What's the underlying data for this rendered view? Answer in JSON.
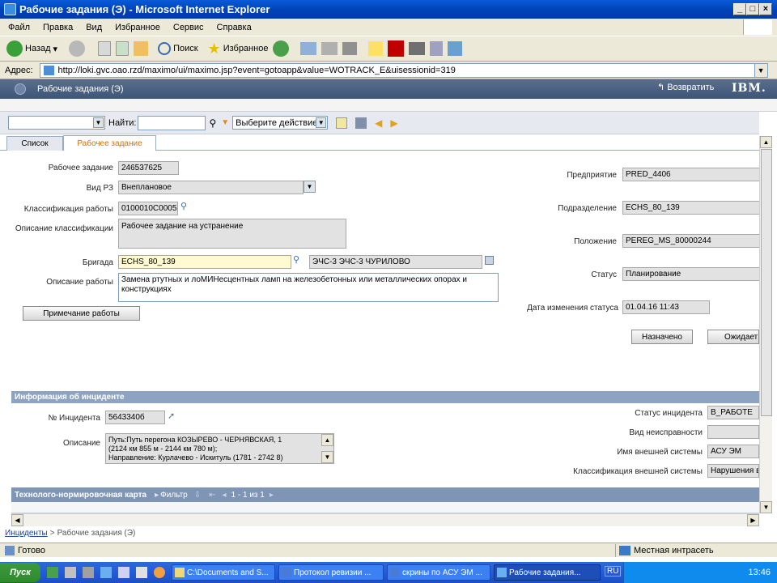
{
  "window": {
    "title": "Рабочие задания (Э) - Microsoft Internet Explorer"
  },
  "menu": [
    "Файл",
    "Правка",
    "Вид",
    "Избранное",
    "Сервис",
    "Справка"
  ],
  "ie_toolbar": {
    "back": "Назад",
    "search": "Поиск",
    "favorites": "Избранное"
  },
  "address": {
    "label": "Адрес:",
    "url": "http://loki.gvc.oao.rzd/maximo/ui/maximo.jsp?event=gotoapp&value=WOTRACK_E&uisessionid=319"
  },
  "app": {
    "title": "Рабочие задания (Э)",
    "return_label": "Возвратить",
    "brand": "IBM."
  },
  "app_toolbar": {
    "find_label": "Найти:",
    "action_select": "Выберите действие"
  },
  "tabs": [
    {
      "label": "Список"
    },
    {
      "label": "Рабочее задание"
    }
  ],
  "form": {
    "wo_label": "Рабочее задание",
    "wo_value": "246537625",
    "type_label": "Вид РЗ",
    "type_value": "Внеплановое",
    "class_label": "Классификация работы",
    "class_value": "0100010C00052",
    "classdesc_label": "Описание классификации",
    "classdesc_value": "Рабочее задание на устранение",
    "crew_label": "Бригада",
    "crew_value": "ECHS_80_139",
    "crew_desc": "ЭЧС-3 ЭЧС-3 ЧУРИЛОВО",
    "desc_label": "Описание работы",
    "desc_value": "Замена ртутных и лоМИНесцентных ламп на железобетонных или металлических опорах и конструкциях",
    "note_button": "Примечание работы",
    "company_label": "Предприятие",
    "company_value": "PRED_4406",
    "dept_label": "Подразделение",
    "dept_value": "ECHS_80_139",
    "location_label": "Положение",
    "location_value": "PEREG_MS_80000244",
    "status_label": "Статус",
    "status_value": "Планирование",
    "statusdate_label": "Дата изменения статуса",
    "statusdate_value": "01.04.16 11:43",
    "btn_assigned": "Назначено",
    "btn_waiting": "Ожидает"
  },
  "incident": {
    "section_title": "Информация об инциденте",
    "num_label": "№ Инцидента",
    "num_value": "5643340б",
    "desc_label": "Описание",
    "desc_lines": [
      "Путь:Путь перегона КОЗЫРЕВО - ЧЕРНЯВСКАЯ, 1",
      "(2124 км 855 м - 2144 км 780 м);",
      "Направление: Курлачево - Искитуль (1781 - 2742 8)"
    ],
    "status_label": "Статус инцидента",
    "status_value": "В_РАБОТЕ",
    "faulttype_label": "Вид неисправности",
    "faulttype_value": "",
    "extsys_label": "Имя внешней системы",
    "extsys_value": "АСУ ЭМ",
    "extclass_label": "Классификация внешней системы",
    "extclass_value": "Нарушения в"
  },
  "tech_section": {
    "title": "Технолого-нормировочная карта",
    "filter": "Фильтр",
    "pager": "1 - 1 из 1"
  },
  "breadcrumb": {
    "link": "Инциденты",
    "sep": ">",
    "current": "Рабочие задания (Э)"
  },
  "statusbar": {
    "left": "Готово",
    "zone": "Местная интрасеть"
  },
  "taskbar": {
    "start": "Пуск",
    "tasks": [
      "C:\\Documents and S...",
      "Протокол ревизии ...",
      "скрины по АСУ ЭМ ...",
      "Рабочие задания..."
    ],
    "lang": "RU",
    "clock": "13:46"
  }
}
